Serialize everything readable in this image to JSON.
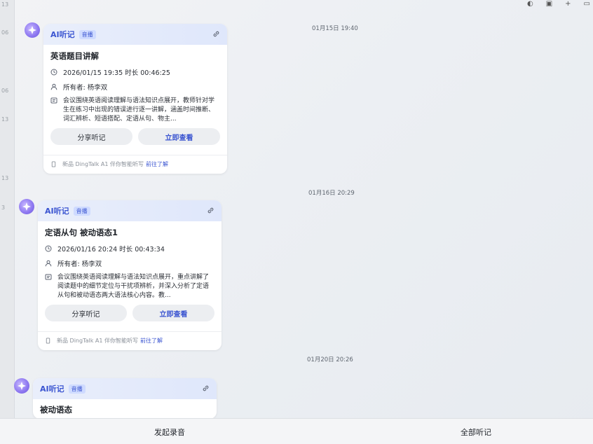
{
  "side_numbers": [
    "13",
    "06",
    "06",
    "13",
    "13",
    "3"
  ],
  "top_icons": [
    "moon-icon",
    "copy-icon",
    "plus-icon",
    "window-icon"
  ],
  "timestamps": [
    "01月15日 19:40",
    "01月16日 20:29",
    "01月20日 20:26"
  ],
  "cards": [
    {
      "app_name": "AI听记",
      "tag": "音播",
      "title": "英语题目讲解",
      "datetime": "2026/01/15 19:35 时长 00:46:25",
      "owner": "所有者: 杨李双",
      "summary": "会议围绕英语阅读理解与语法知识点展开，教师针对学生在练习中出现的错误进行逐一讲解，涵盖时间推断、词汇辨析、短语搭配、定语从句、物主...",
      "share_label": "分享听记",
      "view_label": "立即查看",
      "footer_text": "新品 DingTalk A1 伴你智能听写",
      "footer_link": "前往了解"
    },
    {
      "app_name": "AI听记",
      "tag": "音播",
      "title": "定语从句 被动语态1",
      "datetime": "2026/01/16 20:24 时长 00:43:34",
      "owner": "所有者: 杨李双",
      "summary": "会议围绕英语阅读理解与语法知识点展开，重点讲解了阅读题中的细节定位与干扰项辨析，并深入分析了定语从句和被动语态两大语法核心内容。教...",
      "share_label": "分享听记",
      "view_label": "立即查看",
      "footer_text": "新品 DingTalk A1 伴你智能听写",
      "footer_link": "前往了解"
    },
    {
      "app_name": "AI听记",
      "tag": "音播",
      "title": "被动语态"
    }
  ],
  "bottom_bar": {
    "record_label": "发起录音",
    "all_label": "全部听记"
  },
  "colors": {
    "accent": "#3b55d1",
    "avatar": "#8c76f0"
  }
}
